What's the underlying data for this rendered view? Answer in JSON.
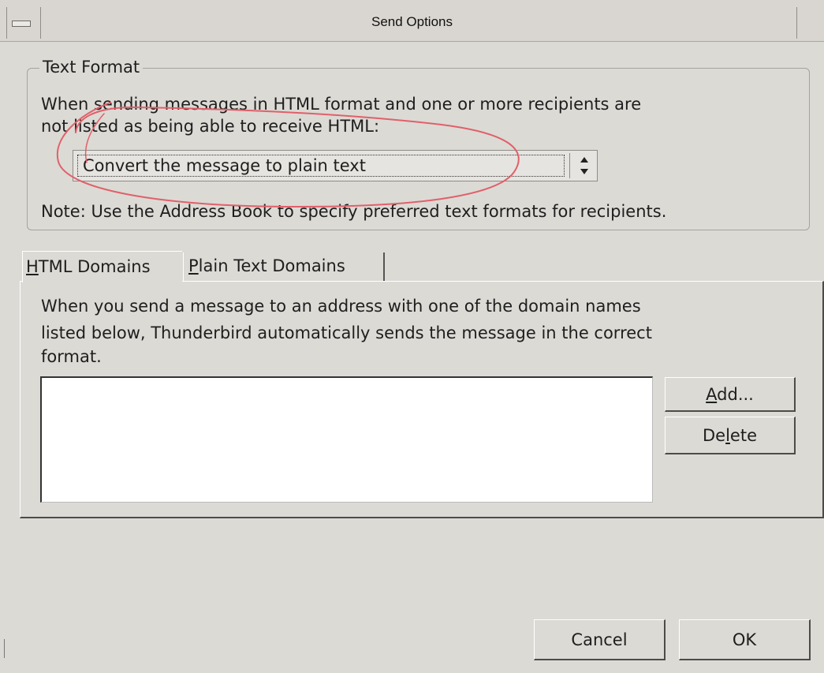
{
  "window": {
    "title": "Send Options"
  },
  "text_format": {
    "legend": "Text Format",
    "description_line1": "When sending messages in HTML format and one or more recipients are",
    "description_line2": "not listed as being able to receive HTML:",
    "select_value": "Convert the message to plain text",
    "select_arrows": "◆",
    "note": "Note: Use the Address Book to specify preferred text formats for recipients."
  },
  "tabs": [
    {
      "prefix": "H",
      "label": "TML Domains"
    },
    {
      "prefix": "P",
      "label": "lain Text Domains"
    }
  ],
  "html_domains_panel": {
    "description_line1": "When you send a message to an address with one of the domain names",
    "description_line2": "listed below, Thunderbird automatically sends the message in the correct",
    "description_line3": "format."
  },
  "buttons": {
    "add_prefix": "A",
    "add_rest": "dd...",
    "delete_pre": "De",
    "delete_u": "l",
    "delete_post": "ete",
    "cancel": "Cancel",
    "ok": "OK"
  },
  "colors": {
    "window_bg": "#dcdad5",
    "annotation": "#e0606a"
  }
}
